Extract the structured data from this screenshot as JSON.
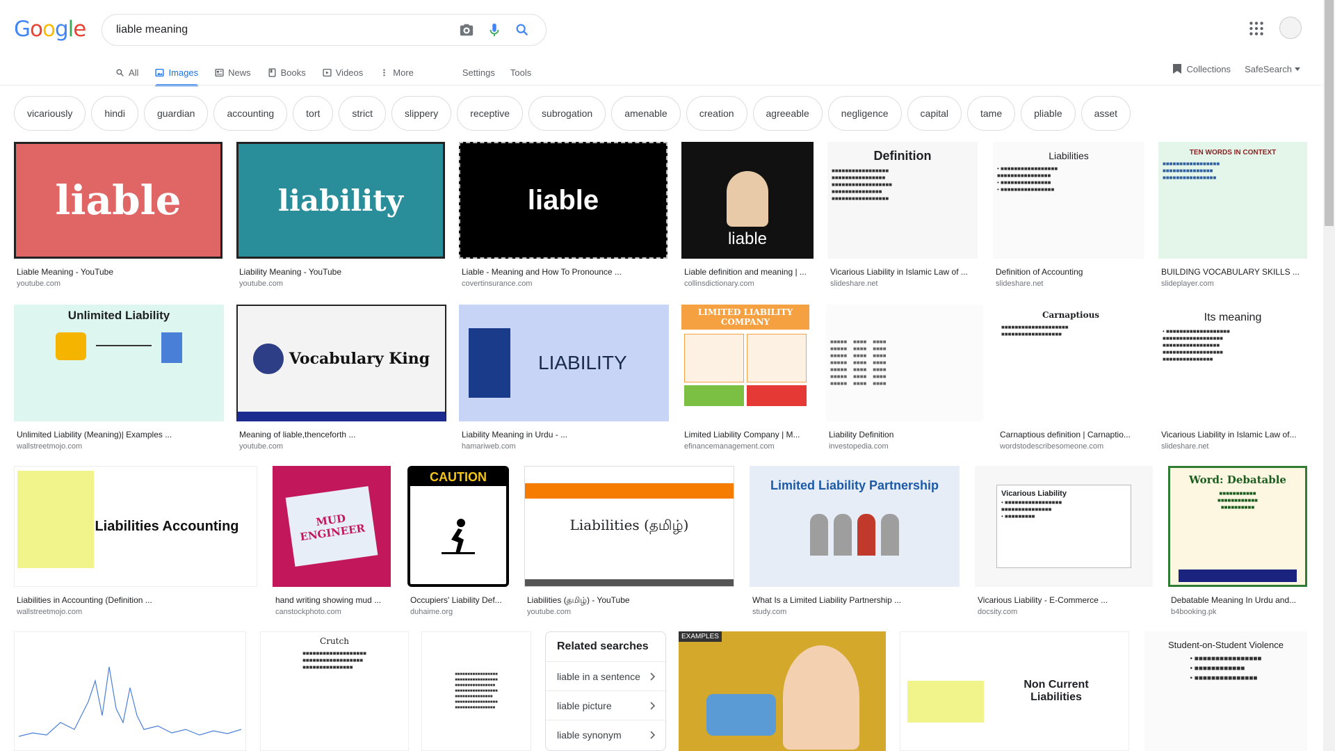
{
  "logo": [
    "G",
    "o",
    "o",
    "g",
    "l",
    "e"
  ],
  "search": {
    "value": "liable meaning"
  },
  "tabs": [
    {
      "label": "All",
      "icon": "search-icon"
    },
    {
      "label": "Images",
      "icon": "image-icon",
      "active": true
    },
    {
      "label": "News",
      "icon": "news-icon"
    },
    {
      "label": "Books",
      "icon": "book-icon"
    },
    {
      "label": "Videos",
      "icon": "video-icon"
    },
    {
      "label": "More",
      "icon": "more-vertical-icon"
    }
  ],
  "tools": {
    "settings": "Settings",
    "tools": "Tools"
  },
  "right": {
    "collections": "Collections",
    "safesearch": "SafeSearch"
  },
  "chips": [
    "vicariously",
    "hindi",
    "guardian",
    "accounting",
    "tort",
    "strict",
    "slippery",
    "receptive",
    "subrogation",
    "amenable",
    "creation",
    "agreeable",
    "negligence",
    "capital",
    "tame",
    "pliable",
    "asset"
  ],
  "results": [
    {
      "caption": "Liable Meaning - YouTube",
      "source": "youtube.com",
      "thumb_text": "liable"
    },
    {
      "caption": "Liability Meaning - YouTube",
      "source": "youtube.com",
      "thumb_text": "liability"
    },
    {
      "caption": "Liable - Meaning and How To Pronounce ...",
      "source": "covertinsurance.com",
      "thumb_text": "liable"
    },
    {
      "caption": "Liable definition and meaning | ...",
      "source": "collinsdictionary.com",
      "thumb_text": "liable"
    },
    {
      "caption": "Vicarious Liability in Islamic Law of ...",
      "source": "slideshare.net",
      "thumb_text": "Definition"
    },
    {
      "caption": "Definition of Accounting",
      "source": "slideshare.net",
      "thumb_text": "Liabilities"
    },
    {
      "caption": "BUILDING VOCABULARY SKILLS ...",
      "source": "slideplayer.com",
      "thumb_text": "TEN WORDS IN CONTEXT"
    },
    {
      "caption": "Unlimited Liability (Meaning)| Examples ...",
      "source": "wallstreetmojo.com",
      "thumb_text": "Unlimited Liability"
    },
    {
      "caption": "Meaning of liable,thenceforth ...",
      "source": "youtube.com",
      "thumb_text": "Vocabulary King"
    },
    {
      "caption": "Liability Meaning in Urdu - ...",
      "source": "hamariweb.com",
      "thumb_text": "LIABILITY"
    },
    {
      "caption": "Limited Liability Company | M...",
      "source": "efinancemanagement.com",
      "thumb_text": "LIMITED LIABILITY COMPANY"
    },
    {
      "caption": "Liability Definition",
      "source": "investopedia.com",
      "thumb_text": ""
    },
    {
      "caption": "Carnaptious definition | Carnaptio...",
      "source": "wordstodescribesomeone.com",
      "thumb_text": "Carnaptious"
    },
    {
      "caption": "Vicarious Liability in Islamic Law of...",
      "source": "slideshare.net",
      "thumb_text": "Its meaning"
    },
    {
      "caption": "Liabilities in Accounting (Definition ...",
      "source": "wallstreetmojo.com",
      "thumb_text": "Liabilities Accounting"
    },
    {
      "caption": "hand writing showing mud ...",
      "source": "canstockphoto.com",
      "thumb_text": "MUD ENGINEER"
    },
    {
      "caption": "Occupiers' Liability Def...",
      "source": "duhaime.org",
      "thumb_text": "CAUTION"
    },
    {
      "caption": "Liabilities (தமிழ்) - YouTube",
      "source": "youtube.com",
      "thumb_text": "Liabilities (தமிழ்)"
    },
    {
      "caption": "What Is a Limited Liability Partnership ...",
      "source": "study.com",
      "thumb_text": "Limited Liability Partnership"
    },
    {
      "caption": "Vicarious Liability - E-Commerce ...",
      "source": "docsity.com",
      "thumb_text": "Vicarious Liability"
    },
    {
      "caption": "Debatable Meaning In Urdu and...",
      "source": "b4booking.pk",
      "thumb_text": "Word: Debatable"
    },
    {
      "caption": "",
      "source": "",
      "thumb_text": ""
    },
    {
      "caption": "",
      "source": "",
      "thumb_text": "Crutch"
    },
    {
      "caption": "",
      "source": "",
      "thumb_text": ""
    },
    {
      "caption": "",
      "source": "",
      "thumb_text": "EXAMPLES"
    },
    {
      "caption": "",
      "source": "",
      "thumb_text": "Non Current Liabilities"
    },
    {
      "caption": "",
      "source": "",
      "thumb_text": "Student-on-Student Violence"
    }
  ],
  "related": {
    "title": "Related searches",
    "items": [
      "liable in a sentence",
      "liable picture",
      "liable synonym"
    ]
  }
}
